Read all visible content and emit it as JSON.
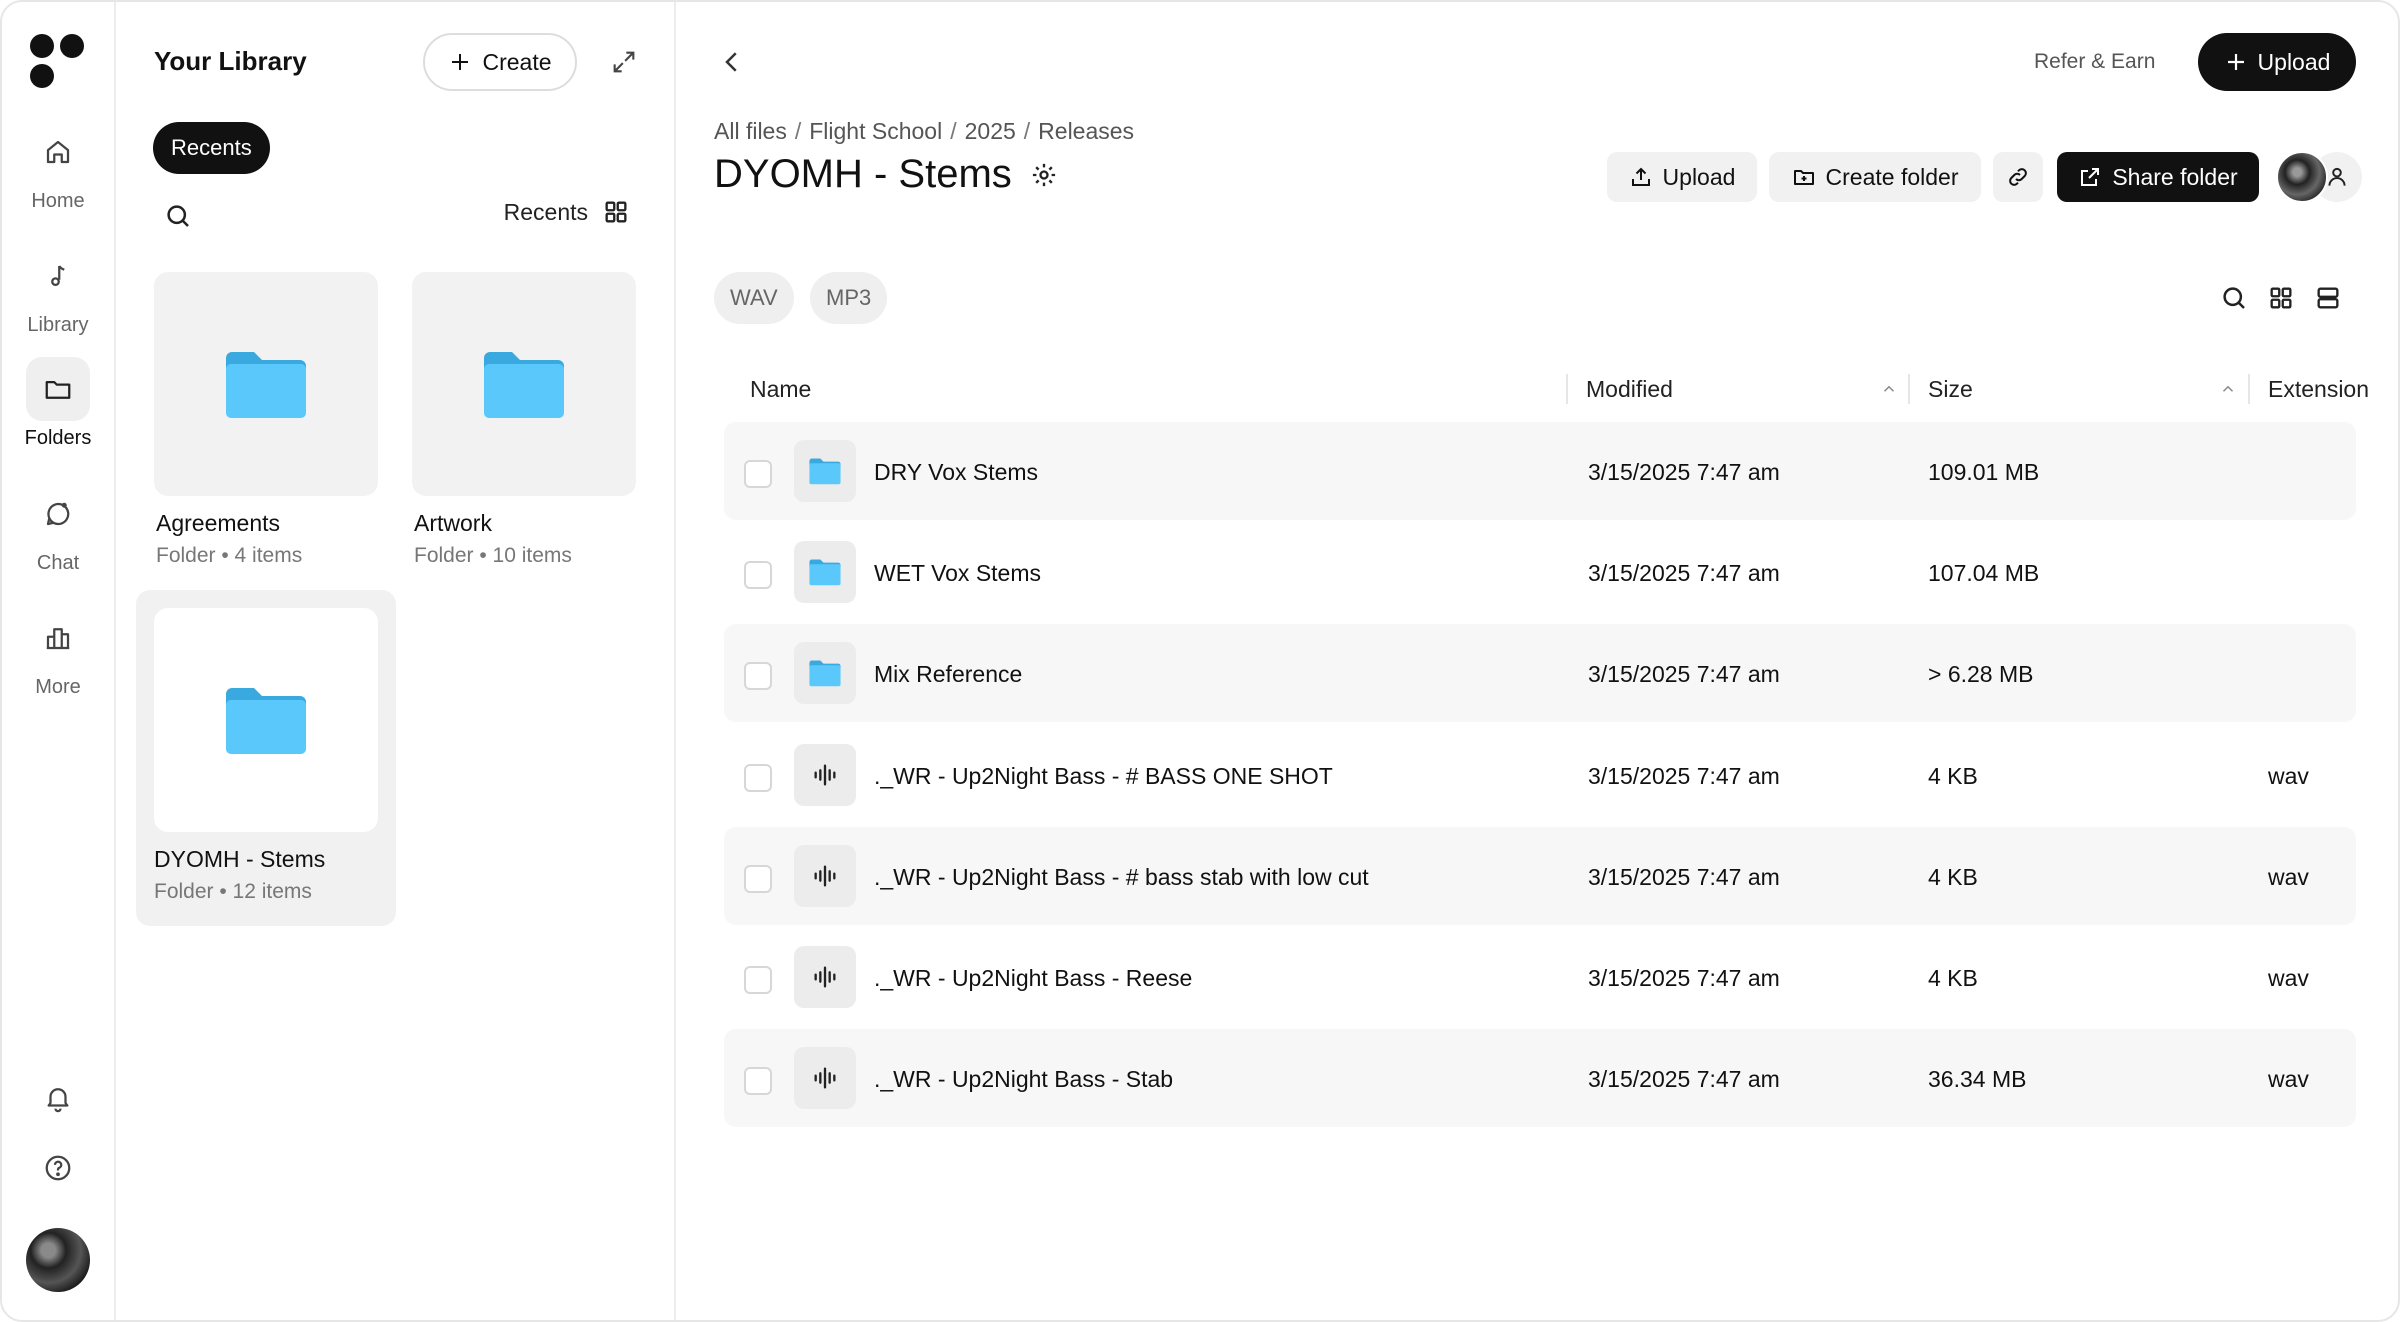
{
  "rail": {
    "items": [
      {
        "label": "Home",
        "icon": "home-icon"
      },
      {
        "label": "Library",
        "icon": "music-note-icon"
      },
      {
        "label": "Folders",
        "icon": "folder-icon"
      },
      {
        "label": "Chat",
        "icon": "chat-icon"
      },
      {
        "label": "More",
        "icon": "bar-chart-icon"
      }
    ],
    "active": "Folders"
  },
  "library": {
    "title": "Your Library",
    "create_label": "Create",
    "recents_chip": "Recents",
    "sort_label": "Recents",
    "cards": [
      {
        "name": "Agreements",
        "meta": "Folder • 4 items"
      },
      {
        "name": "Artwork",
        "meta": "Folder • 10 items"
      },
      {
        "name": "DYOMH - Stems",
        "meta": "Folder • 12 items"
      }
    ]
  },
  "header": {
    "refer_label": "Refer & Earn",
    "upload_label": "Upload"
  },
  "breadcrumb": [
    "All files",
    "Flight School",
    "2025",
    "Releases"
  ],
  "folder": {
    "title": "DYOMH - Stems",
    "actions": {
      "upload": "Upload",
      "create_folder": "Create folder",
      "share_folder": "Share folder"
    }
  },
  "filters": [
    "WAV",
    "MP3"
  ],
  "table": {
    "columns": {
      "name": "Name",
      "modified": "Modified",
      "size": "Size",
      "extension": "Extension"
    },
    "rows": [
      {
        "type": "folder",
        "name": "DRY Vox Stems",
        "modified": "3/15/2025 7:47 am",
        "size": "109.01 MB",
        "extension": ""
      },
      {
        "type": "folder",
        "name": "WET Vox Stems",
        "modified": "3/15/2025 7:47 am",
        "size": "107.04 MB",
        "extension": ""
      },
      {
        "type": "folder",
        "name": "Mix Reference",
        "modified": "3/15/2025 7:47 am",
        "size": "> 6.28 MB",
        "extension": ""
      },
      {
        "type": "audio",
        "name": "._WR - Up2Night Bass - # BASS ONE SHOT",
        "modified": "3/15/2025 7:47 am",
        "size": "4 KB",
        "extension": "wav"
      },
      {
        "type": "audio",
        "name": "._WR - Up2Night Bass - # bass stab with low cut",
        "modified": "3/15/2025 7:47 am",
        "size": "4 KB",
        "extension": "wav"
      },
      {
        "type": "audio",
        "name": "._WR - Up2Night Bass - Reese",
        "modified": "3/15/2025 7:47 am",
        "size": "4 KB",
        "extension": "wav"
      },
      {
        "type": "audio",
        "name": "._WR - Up2Night Bass - Stab",
        "modified": "3/15/2025 7:47 am",
        "size": "36.34 MB",
        "extension": "wav"
      }
    ]
  },
  "colors": {
    "folder_blue": "#5ac8fa",
    "folder_blue_dark": "#3aa9e0",
    "accent_dark": "#111111"
  }
}
